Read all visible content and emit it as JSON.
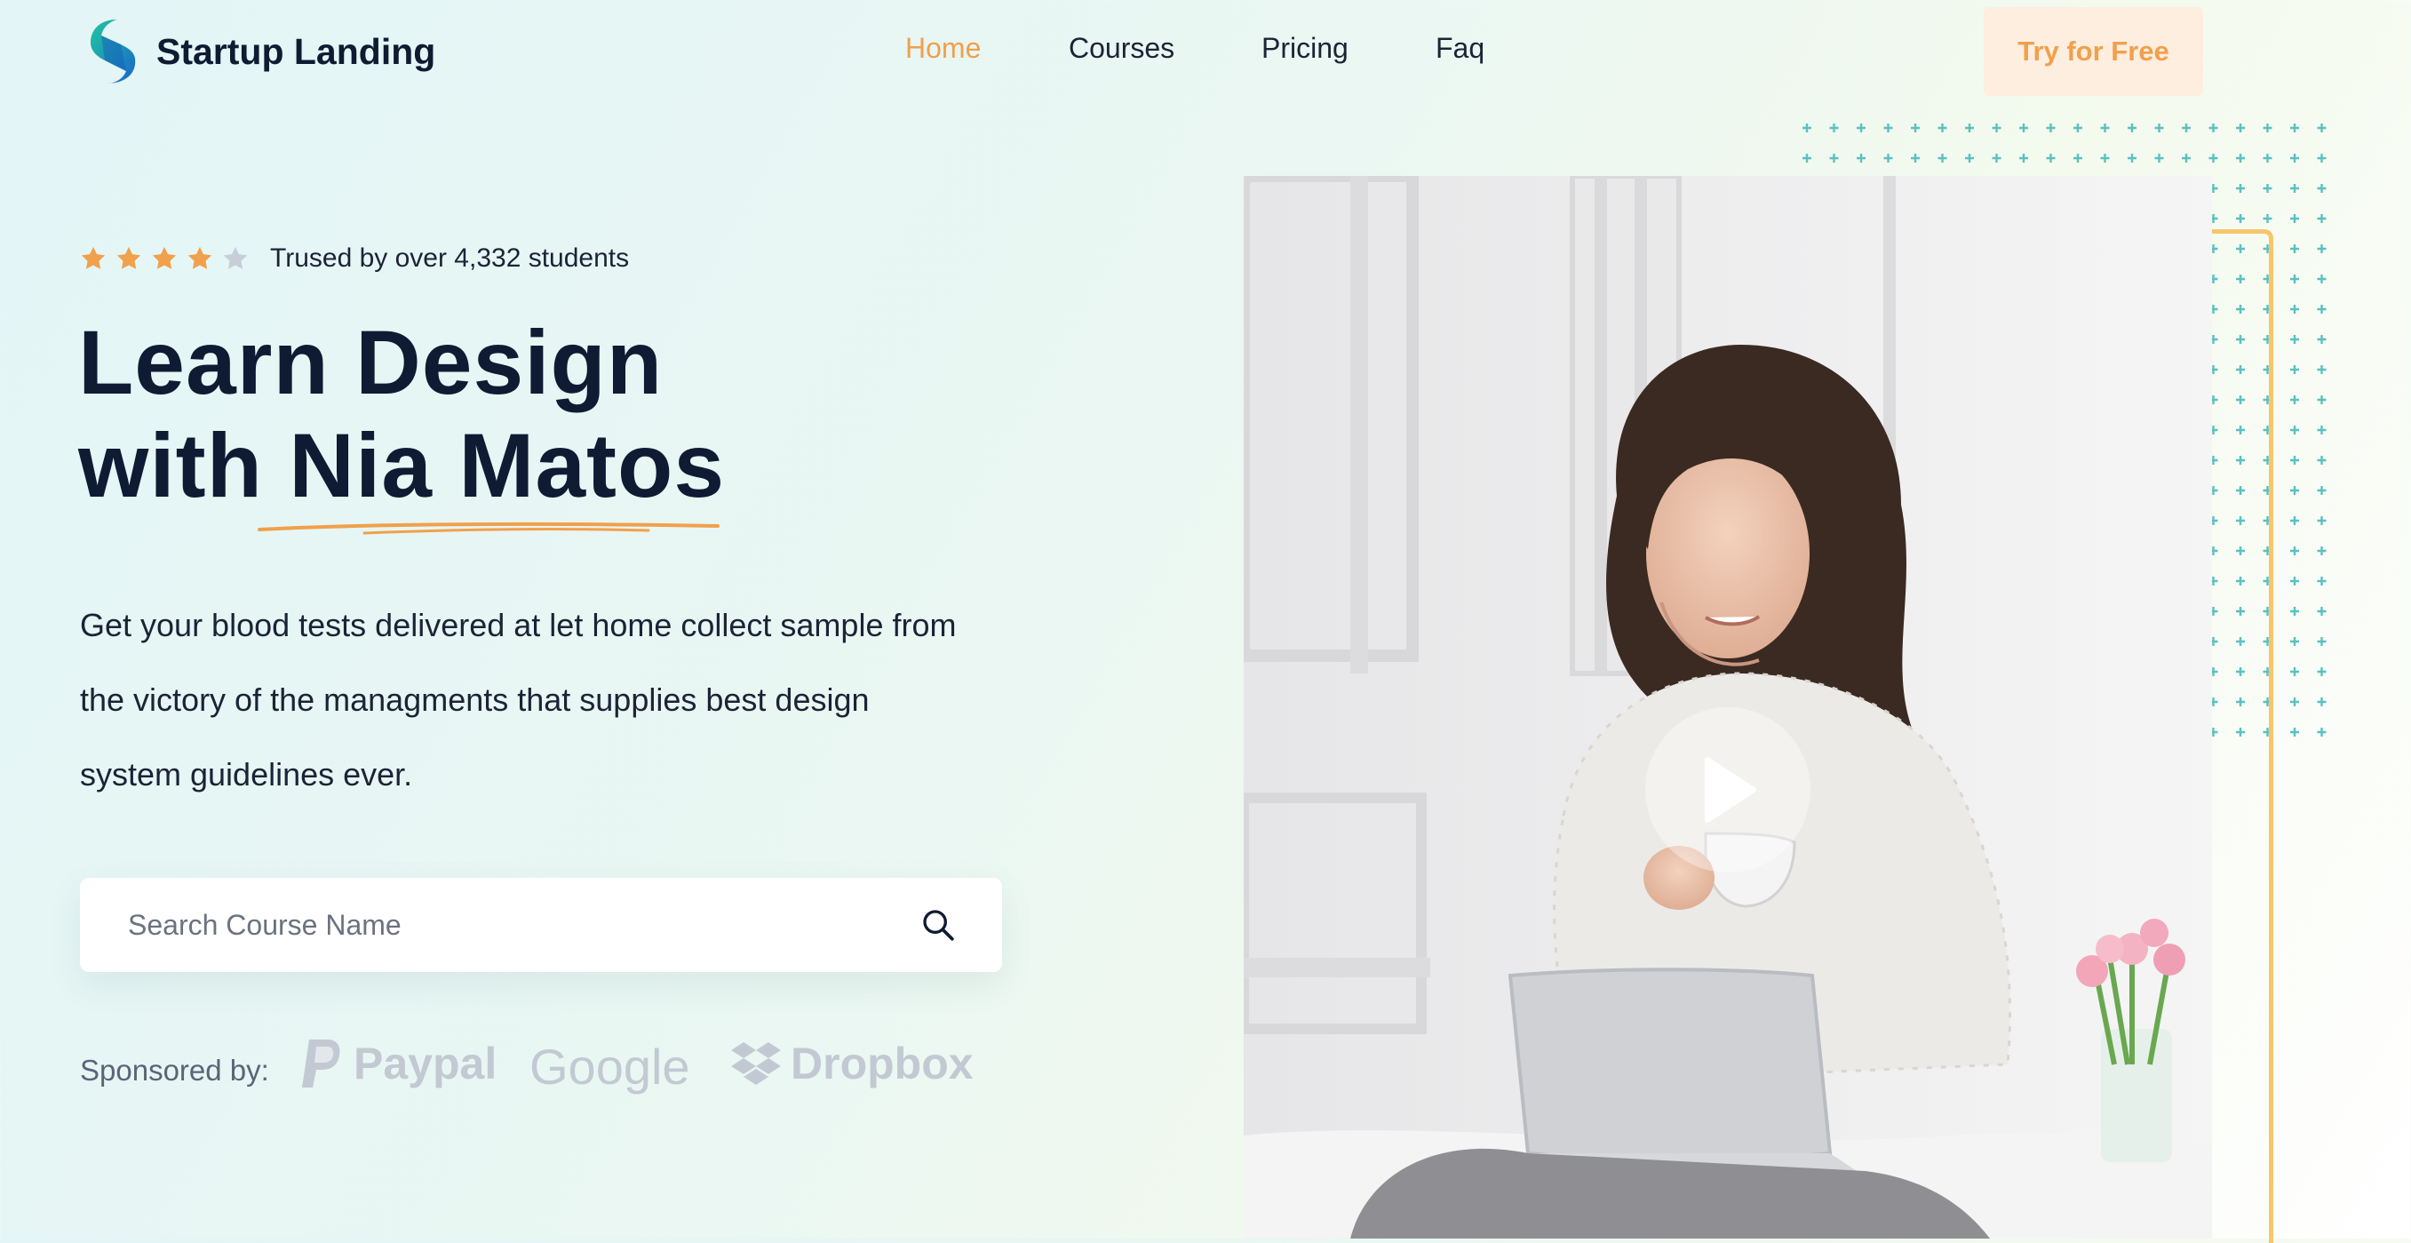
{
  "brand": {
    "name": "Startup Landing"
  },
  "nav": {
    "items": [
      {
        "label": "Home",
        "active": true
      },
      {
        "label": "Courses",
        "active": false
      },
      {
        "label": "Pricing",
        "active": false
      },
      {
        "label": "Faq",
        "active": false
      }
    ],
    "cta_label": "Try for Free"
  },
  "hero": {
    "rating": {
      "stars": 4,
      "max": 5,
      "text": "Trused by over 4,332 students"
    },
    "headline_line1": "Learn Design",
    "headline_line2": "with Nia Matos",
    "description": "Get your blood tests delivered at let home collect sample from the victory of the managments that supplies best design system guidelines ever.",
    "search": {
      "placeholder": "Search Course Name",
      "value": ""
    },
    "sponsors": {
      "label": "Sponsored by:",
      "items": [
        "Paypal",
        "Google",
        "Dropbox"
      ]
    }
  },
  "colors": {
    "accent": "#f1a04b",
    "dark": "#0f1b33",
    "cta_bg": "#fdeee0",
    "frame": "#f7c66a",
    "dots": "#5bc0c0",
    "sponsor_gray": "#c3c9d3"
  },
  "icons": [
    "logo-icon",
    "star-icon",
    "search-icon",
    "play-icon",
    "paypal-icon",
    "dropbox-icon"
  ]
}
